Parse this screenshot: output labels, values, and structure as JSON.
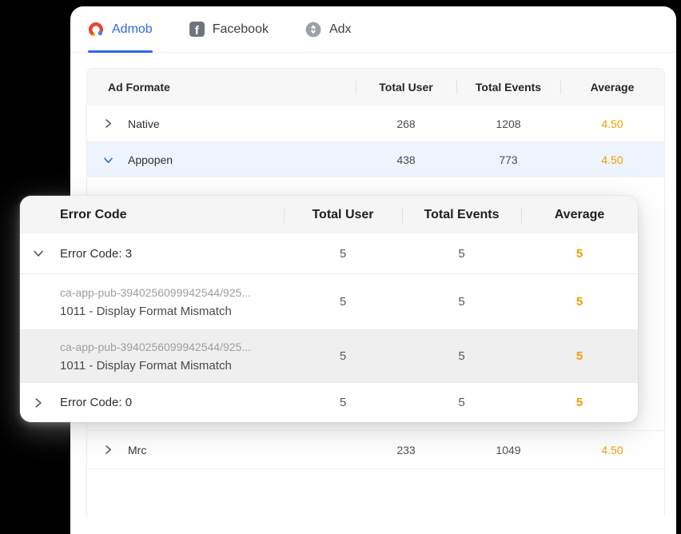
{
  "colors": {
    "accent_blue": "#2d6ae3",
    "accent_orange": "#f59b00",
    "admob_red": "#EA4335",
    "admob_yellow": "#FBBC04",
    "admob_blue": "#4285F4"
  },
  "tabs": [
    {
      "label": "Admob",
      "active": true
    },
    {
      "label": "Facebook",
      "active": false
    },
    {
      "label": "Adx",
      "active": false
    }
  ],
  "icons": {
    "facebook_glyph": "f"
  },
  "main_table": {
    "columns": [
      "Ad Formate",
      "Total User",
      "Total Events",
      "Average"
    ],
    "rows": [
      {
        "label": "Native",
        "expanded": false,
        "total_user": "268",
        "total_events": "1208",
        "average": "4.50"
      },
      {
        "label": "Appopen",
        "expanded": true,
        "total_user": "438",
        "total_events": "773",
        "average": "4.50"
      },
      {
        "label": "Mrc",
        "expanded": false,
        "total_user": "233",
        "total_events": "1049",
        "average": "4.50"
      }
    ]
  },
  "error_panel": {
    "columns": [
      "Error Code",
      "Total User",
      "Total Events",
      "Average"
    ],
    "rows": [
      {
        "kind": "group",
        "label": "Error Code: 3",
        "expanded": true,
        "total_user": "5",
        "total_events": "5",
        "average": "5"
      },
      {
        "kind": "detail",
        "ad_unit": "ca-app-pub-3940256099942544/925...",
        "error_name": "1011 - Display Format Mismatch",
        "total_user": "5",
        "total_events": "5",
        "average": "5"
      },
      {
        "kind": "detail",
        "ad_unit": "ca-app-pub-3940256099942544/925...",
        "error_name": "1011 - Display Format Mismatch",
        "total_user": "5",
        "total_events": "5",
        "average": "5"
      },
      {
        "kind": "group",
        "label": "Error Code: 0",
        "expanded": false,
        "total_user": "5",
        "total_events": "5",
        "average": "5"
      }
    ]
  }
}
